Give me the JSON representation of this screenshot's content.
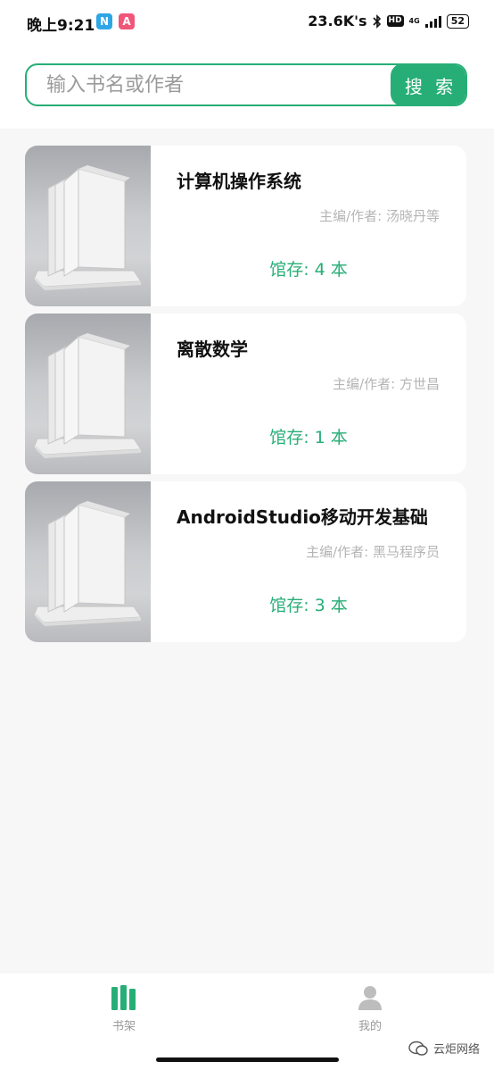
{
  "status_bar": {
    "time": "晚上9:21",
    "badge_n": "N",
    "badge_a": "A",
    "network_speed": "23.6K's",
    "hd": "HD",
    "network_type": "4G",
    "battery": "52"
  },
  "search": {
    "placeholder": "输入书名或作者",
    "button_label": "搜 索"
  },
  "books": [
    {
      "title": "计算机操作系统",
      "author": "主编/作者: 汤晓丹等",
      "stock": "馆存: 4 本"
    },
    {
      "title": "离散数学",
      "author": "主编/作者: 方世昌",
      "stock": "馆存: 1 本"
    },
    {
      "title": "AndroidStudio移动开发基础",
      "author": "主编/作者: 黑马程序员",
      "stock": "馆存: 3 本"
    }
  ],
  "nav": {
    "shelf_label": "书架",
    "mine_label": "我的"
  },
  "watermark": "云炬网络",
  "colors": {
    "accent": "#27ae76",
    "background": "#f7f7f7",
    "card": "#ffffff",
    "muted_text": "#b5b5b5"
  },
  "icons": [
    "bluetooth-icon",
    "signal-icon",
    "battery-icon",
    "book-cover-image",
    "bookshelf-icon",
    "person-icon",
    "wechat-icon"
  ]
}
